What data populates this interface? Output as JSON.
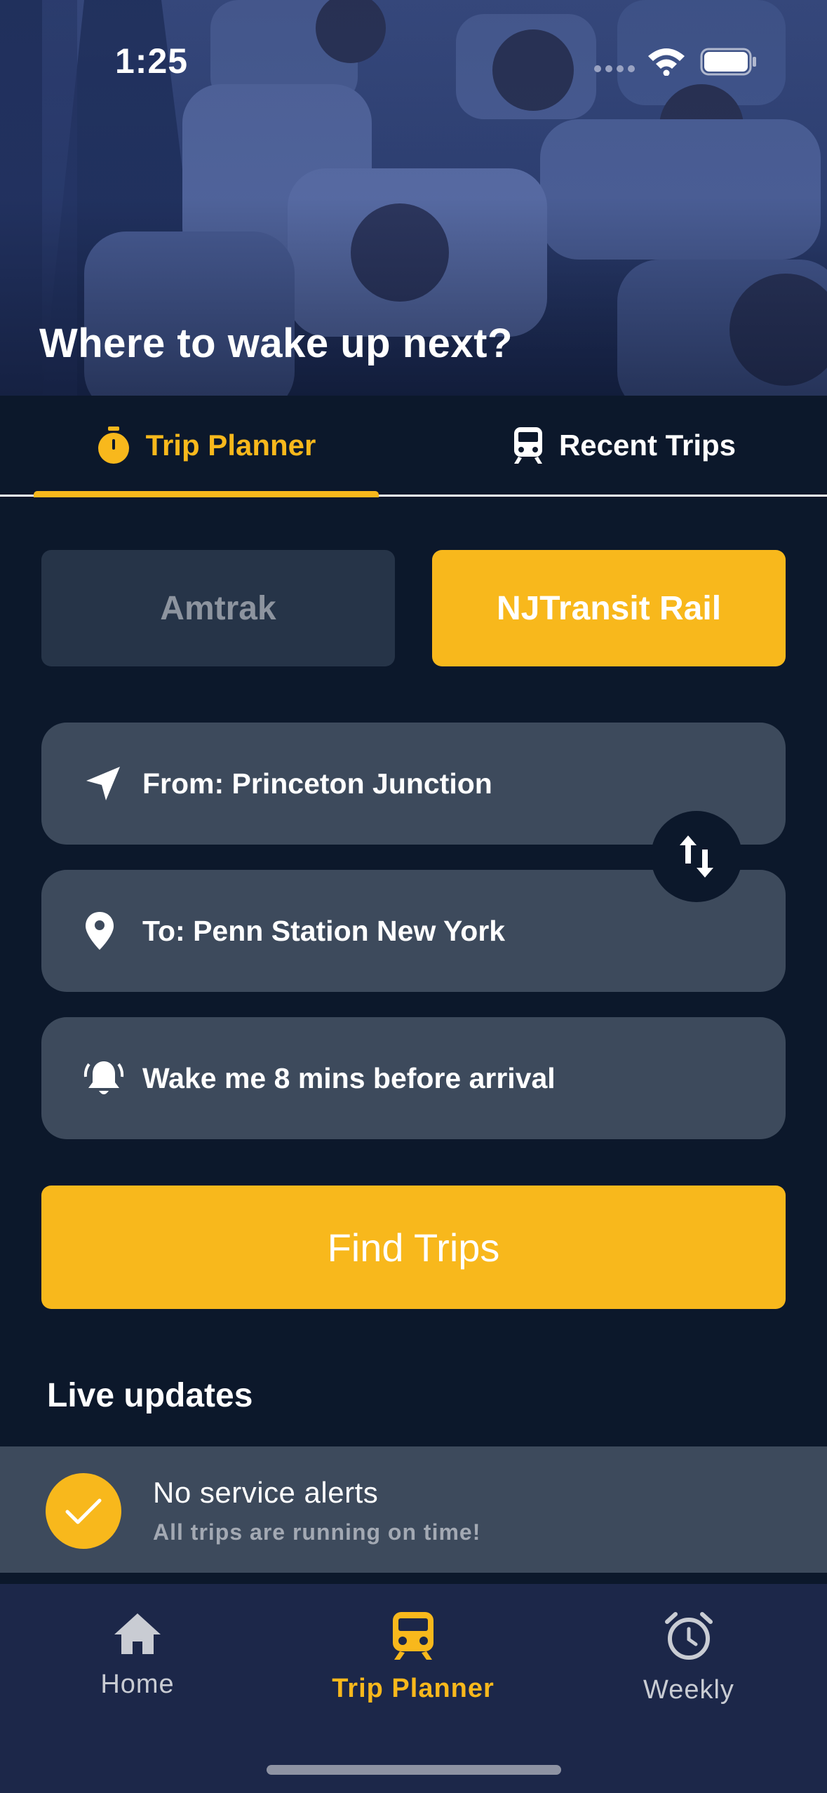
{
  "status_bar": {
    "time": "1:25",
    "icons": [
      "cellular-icon",
      "wifi-icon",
      "battery-icon"
    ]
  },
  "hero": {
    "title": "Where to wake up next?"
  },
  "tabs": [
    {
      "label": "Trip Planner",
      "icon": "stopwatch-icon",
      "active": true
    },
    {
      "label": "Recent Trips",
      "icon": "train-icon",
      "active": false
    }
  ],
  "segments": [
    {
      "label": "Amtrak",
      "selected": false
    },
    {
      "label": "NJTransit Rail",
      "selected": true
    }
  ],
  "fields": {
    "from": {
      "text": "From: Princeton Junction",
      "icon": "navigation-arrow-icon"
    },
    "to": {
      "text": "To: Penn Station New York",
      "icon": "location-pin-icon"
    },
    "wake": {
      "text": "Wake me 8 mins before arrival",
      "icon": "bell-icon"
    }
  },
  "swap_button": {
    "icon": "swap-vertical-icon"
  },
  "find_button": {
    "label": "Find Trips"
  },
  "live_updates": {
    "title": "Live updates",
    "alert": {
      "title": "No service alerts",
      "subtitle": "All trips are running on time!",
      "icon": "check-icon"
    }
  },
  "bottom_nav": [
    {
      "label": "Home",
      "icon": "home-icon",
      "active": false
    },
    {
      "label": "Trip Planner",
      "icon": "train-icon",
      "active": true
    },
    {
      "label": "Weekly",
      "icon": "alarm-clock-icon",
      "active": false
    }
  ],
  "colors": {
    "accent": "#f8b81c",
    "background": "#0c182b",
    "field": "#3d4a5c",
    "nav": "#1c2749"
  }
}
